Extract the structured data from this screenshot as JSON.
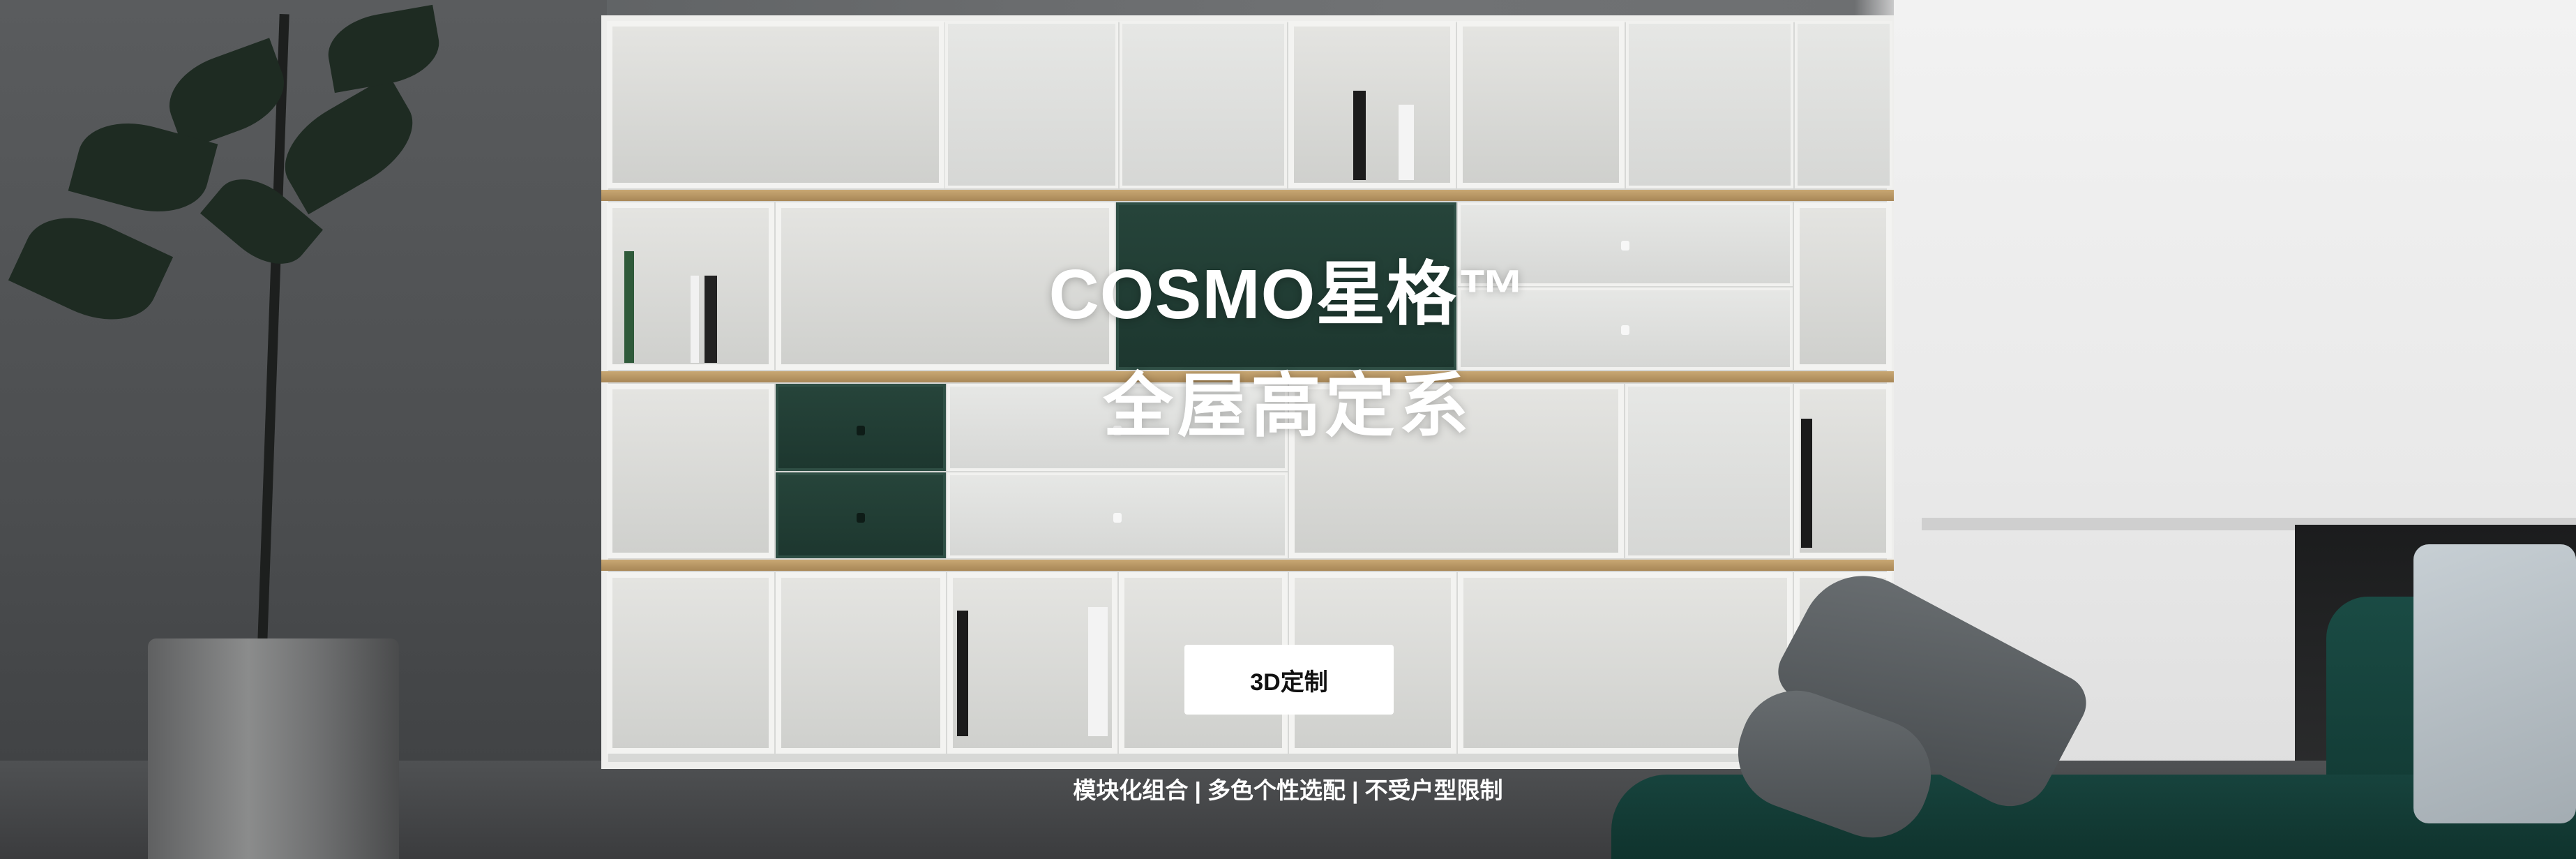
{
  "hero": {
    "title_line1": "COSMO星格™",
    "title_line2": "全屋高定系",
    "cta_label": "3D定制",
    "tagline": "模块化组合 | 多色个性选配 | 不受户型限制"
  },
  "colors": {
    "cabinet_white": "#e6e7e5",
    "cabinet_green": "#1f3a32",
    "oak_accent": "#b8955f",
    "sofa_green": "#15403a",
    "text": "#ffffff",
    "cta_bg": "#ffffff",
    "cta_text": "#111111"
  }
}
